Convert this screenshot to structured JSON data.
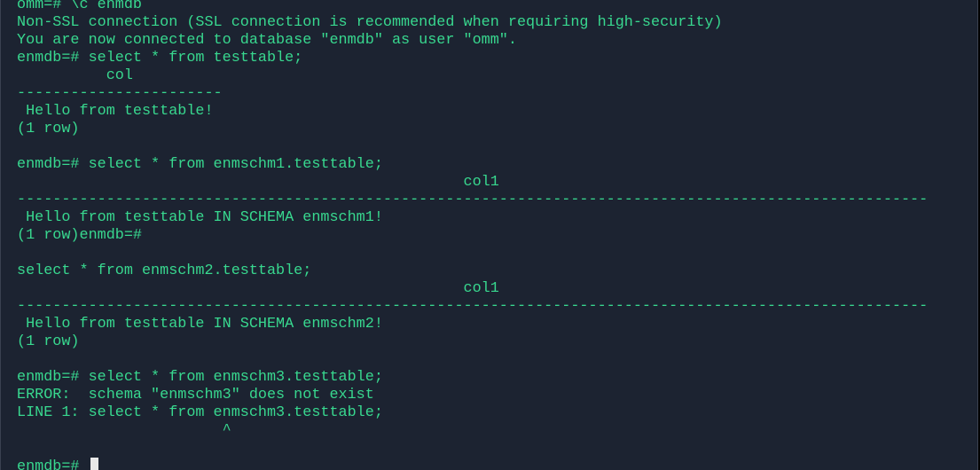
{
  "terminal": {
    "text_color": "#38d88f",
    "background_color": "#1c2331",
    "lines": [
      "omm=# \\c enmdb",
      "Non-SSL connection (SSL connection is recommended when requiring high-security)",
      "You are now connected to database \"enmdb\" as user \"omm\".",
      "enmdb=# select * from testtable;",
      "          col",
      "-----------------------",
      " Hello from testtable!",
      "(1 row)",
      "",
      "enmdb=# select * from enmschm1.testtable;",
      "                                                  col1",
      "------------------------------------------------------------------------------------------------------",
      " Hello from testtable IN SCHEMA enmschm1!",
      "(1 row)enmdb=#",
      "",
      "select * from enmschm2.testtable;",
      "                                                  col1",
      "------------------------------------------------------------------------------------------------------",
      " Hello from testtable IN SCHEMA enmschm2!",
      "(1 row)",
      "",
      "enmdb=# select * from enmschm3.testtable;",
      "ERROR:  schema \"enmschm3\" does not exist",
      "LINE 1: select * from enmschm3.testtable;",
      "                       ^",
      ""
    ],
    "prompt": "enmdb=# "
  }
}
